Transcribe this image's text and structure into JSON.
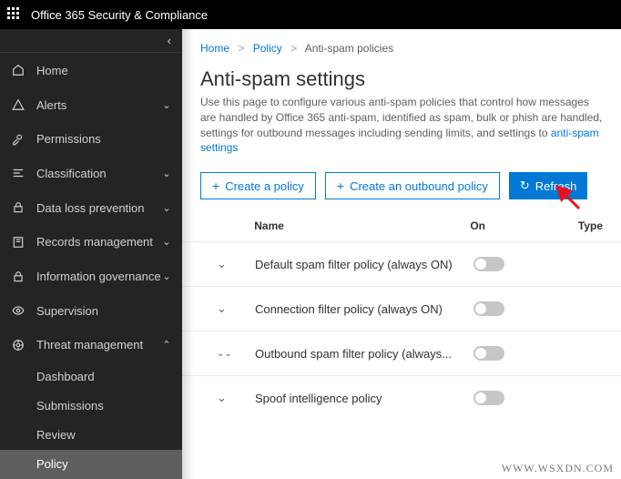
{
  "header": {
    "title": "Office 365 Security & Compliance"
  },
  "sidebar": {
    "items": [
      {
        "label": "Home",
        "icon": "home"
      },
      {
        "label": "Alerts",
        "icon": "alerts",
        "chev": "down"
      },
      {
        "label": "Permissions",
        "icon": "permissions"
      },
      {
        "label": "Classification",
        "icon": "classification",
        "chev": "down"
      },
      {
        "label": "Data loss prevention",
        "icon": "dlp",
        "chev": "down"
      },
      {
        "label": "Records management",
        "icon": "records",
        "chev": "down"
      },
      {
        "label": "Information governance",
        "icon": "governance",
        "chev": "down"
      },
      {
        "label": "Supervision",
        "icon": "supervision"
      },
      {
        "label": "Threat management",
        "icon": "threat",
        "chev": "up"
      }
    ],
    "sub_items": [
      {
        "label": "Dashboard"
      },
      {
        "label": "Submissions"
      },
      {
        "label": "Review"
      },
      {
        "label": "Policy"
      }
    ]
  },
  "breadcrumb": {
    "home": "Home",
    "policy": "Policy",
    "current": "Anti-spam policies"
  },
  "page": {
    "title": "Anti-spam settings",
    "desc": "Use this page to configure various anti-spam policies that control how messages are handled by Office 365 anti-spam, identified as spam, bulk or phish are handled, settings for outbound messages including sending limits, and settings to",
    "link": "anti-spam settings"
  },
  "toolbar": {
    "create_policy": "Create a policy",
    "create_outbound": "Create an outbound policy",
    "refresh": "Refresh"
  },
  "table": {
    "headers": {
      "name": "Name",
      "on": "On",
      "type": "Type"
    },
    "rows": [
      {
        "name": "Default spam filter policy (always ON)"
      },
      {
        "name": "Connection filter policy (always ON)"
      },
      {
        "name": "Outbound spam filter policy (always..."
      },
      {
        "name": "Spoof intelligence policy"
      }
    ]
  },
  "watermark": "WWW.WSXDN.COM"
}
